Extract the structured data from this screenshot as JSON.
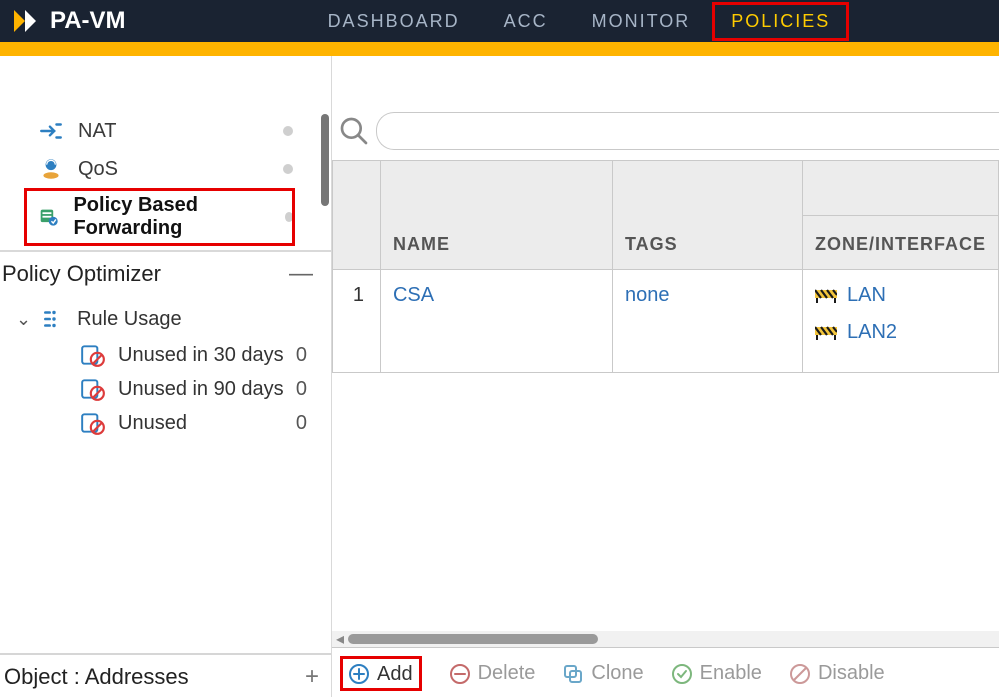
{
  "header": {
    "product": "PA-VM",
    "tabs": [
      {
        "id": "dashboard",
        "label": "DASHBOARD",
        "active": false
      },
      {
        "id": "acc",
        "label": "ACC",
        "active": false
      },
      {
        "id": "monitor",
        "label": "MONITOR",
        "active": false
      },
      {
        "id": "policies",
        "label": "POLICIES",
        "active": true
      }
    ]
  },
  "sidebar": {
    "policies": [
      {
        "id": "nat",
        "label": "NAT",
        "icon": "nat-icon"
      },
      {
        "id": "qos",
        "label": "QoS",
        "icon": "qos-icon"
      },
      {
        "id": "pbf",
        "label": "Policy Based Forwarding",
        "icon": "pbf-icon",
        "selected": true
      }
    ],
    "optimizer_title": "Policy Optimizer",
    "rule_usage": {
      "title": "Rule Usage",
      "items": [
        {
          "label": "Unused in 30 days",
          "count": "0"
        },
        {
          "label": "Unused in 90 days",
          "count": "0"
        },
        {
          "label": "Unused",
          "count": "0"
        }
      ]
    },
    "bottom_panel": "Object : Addresses"
  },
  "grid": {
    "columns": {
      "num": "",
      "name": "NAME",
      "tags": "TAGS",
      "zone": "ZONE/INTERFACE"
    },
    "rows": [
      {
        "num": "1",
        "name": "CSA",
        "tags": "none",
        "zones": [
          "LAN",
          "LAN2"
        ]
      }
    ]
  },
  "actions": {
    "add": "Add",
    "delete": "Delete",
    "clone": "Clone",
    "enable": "Enable",
    "disable": "Disable"
  },
  "search": {
    "placeholder": ""
  }
}
